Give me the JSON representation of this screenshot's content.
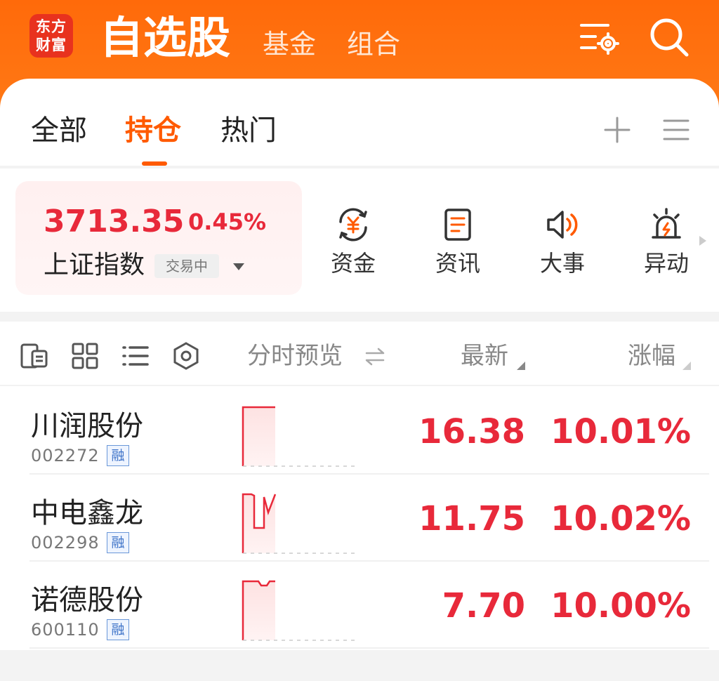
{
  "header": {
    "logo_line1": "东方",
    "logo_line2": "财富",
    "title": "自选股",
    "tabs": [
      "基金",
      "组合"
    ]
  },
  "tabs": {
    "items": [
      "全部",
      "持仓",
      "热门"
    ],
    "active_index": 1
  },
  "index": {
    "value": "3713.35",
    "change_pct": "0.45%",
    "name": "上证指数",
    "status": "交易中"
  },
  "quick_actions": [
    {
      "label": "资金",
      "icon": "yuan-cycle-icon"
    },
    {
      "label": "资讯",
      "icon": "news-doc-icon"
    },
    {
      "label": "大事",
      "icon": "speaker-icon"
    },
    {
      "label": "异动",
      "icon": "alarm-light-icon"
    }
  ],
  "list_header": {
    "preview": "分时预览",
    "latest": "最新",
    "change": "涨幅"
  },
  "stocks": [
    {
      "name": "川润股份",
      "code": "002272",
      "badge": "融",
      "price": "16.38",
      "change": "10.01%"
    },
    {
      "name": "中电鑫龙",
      "code": "002298",
      "badge": "融",
      "price": "11.75",
      "change": "10.02%"
    },
    {
      "name": "诺德股份",
      "code": "600110",
      "badge": "融",
      "price": "7.70",
      "change": "10.00%"
    }
  ],
  "colors": {
    "brand_orange": "#ff6a0a",
    "up_red": "#e8293a",
    "active_tab": "#ff5a00"
  }
}
